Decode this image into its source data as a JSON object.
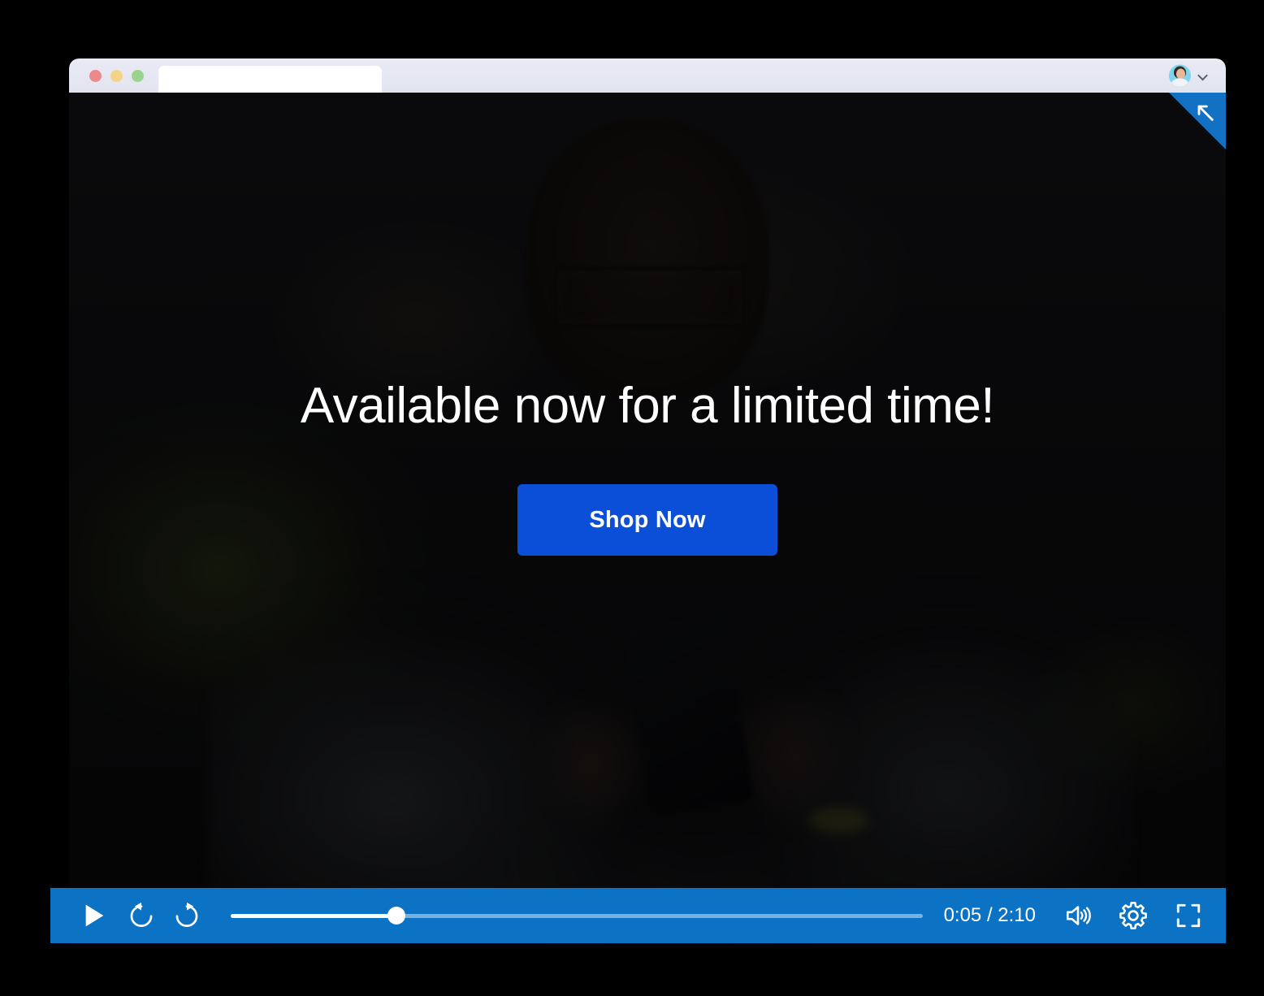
{
  "browser": {
    "traffic_lights": [
      "close",
      "minimize",
      "maximize"
    ],
    "address_bar_value": "",
    "address_bar_placeholder": "",
    "avatar_label": "account-avatar",
    "chevron_label": "chevron-down-icon"
  },
  "video": {
    "corner_badge_icon": "expand-arrow-icon",
    "overlay": {
      "headline": "Available now for a limited time!",
      "cta_label": "Shop Now",
      "cta_color": "#0b4ed8",
      "headline_color": "#ffffff"
    },
    "controls": {
      "bar_color": "#0b72c4",
      "play_label": "play-icon",
      "rewind_label": "rewind-10-icon",
      "forward_label": "forward-10-icon",
      "time_display": "0:05 / 2:10",
      "current_time": "0:05",
      "duration": "2:10",
      "progress_percent": 24,
      "volume_label": "volume-on-icon",
      "settings_label": "settings-gear-icon",
      "fullscreen_label": "fullscreen-icon"
    }
  }
}
